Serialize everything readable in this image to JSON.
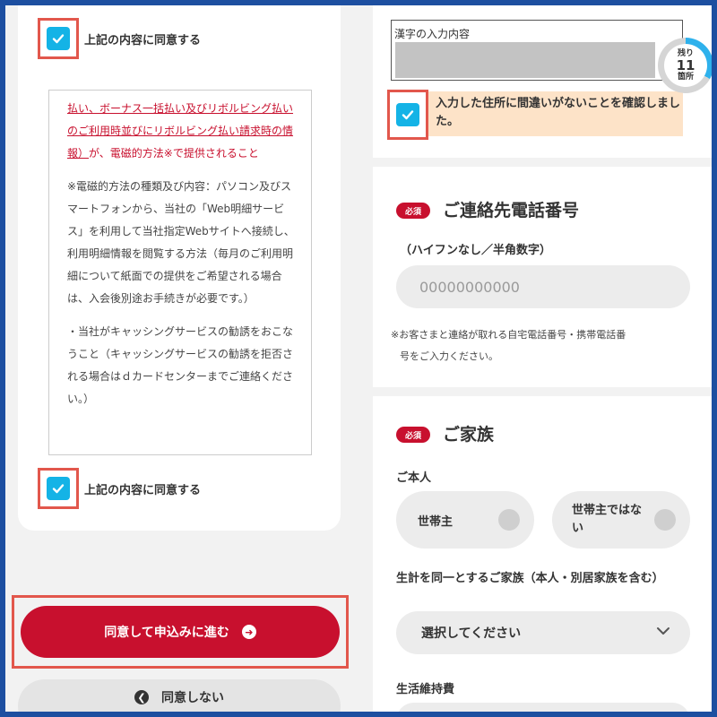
{
  "left": {
    "agree_label_top": "上記の内容に同意する",
    "terms": {
      "para1_link": "払い、ボーナス一括払い及びリボルビング払いのご利用時並びにリボルビング払い請求時の情報）",
      "para1_tail": "が、電磁的方法※で提供されること",
      "para2": "※電磁的方法の種類及び内容：パソコン及びスマートフォンから、当社の「Web明細サービス」を利用して当社指定Webサイトへ接続し、利用明細情報を閲覧する方法（毎月のご利用明細について紙面での提供をご希望される場合は、入会後別途お手続きが必要です。）",
      "para3": "・当社がキャッシングサービスの勧誘をおこなうこと（キャッシングサービスの勧誘を拒否される場合はｄカードセンターまでご連絡ください。）"
    },
    "agree_label_bottom": "上記の内容に同意する",
    "proceed_label": "同意して申込みに進む",
    "decline_label": "同意しない"
  },
  "right": {
    "kanji_label": "漢字の入力内容",
    "remaining": {
      "prefix": "残り",
      "count": "11",
      "suffix": "箇所",
      "progress": 0.33
    },
    "confirm_text": "入力した住所に間違いがないことを確認しました。",
    "phone": {
      "badge": "必須",
      "title": "ご連絡先電話番号",
      "sub": "（ハイフンなし／半角数字）",
      "placeholder": "00000000000",
      "note_line1": "※お客さまと連絡が取れる自宅電話番号・携帯電話番",
      "note_line2": "号をご入力ください。"
    },
    "family": {
      "badge": "必須",
      "title": "ご家族",
      "self_label": "ご本人",
      "option1": "世帯主",
      "option2": "世帯主ではない",
      "household_label": "生計を同一とするご家族（本人・別居家族を含む）",
      "select_placeholder": "選択してください",
      "living_label": "生活維持費"
    }
  },
  "colors": {
    "accent_red": "#c8102e",
    "check_blue": "#14b3e6",
    "highlight": "#e2574c"
  }
}
